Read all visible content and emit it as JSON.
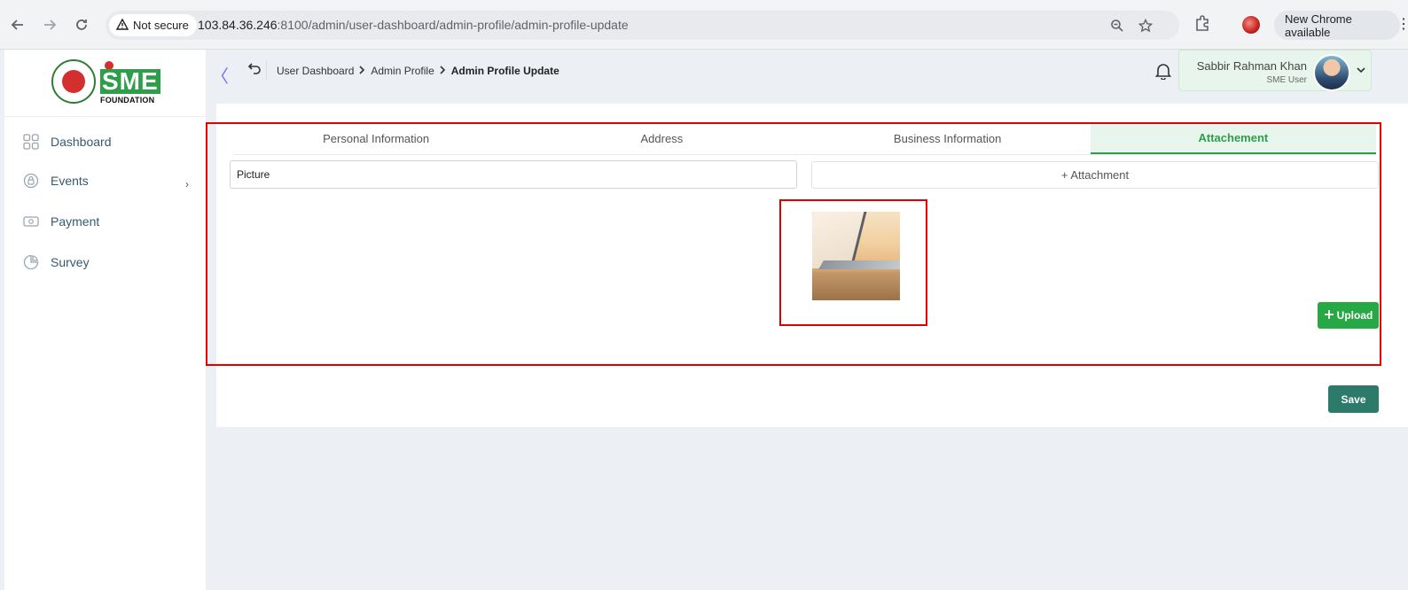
{
  "browser": {
    "security_label": "Not secure",
    "url_host": "103.84.36.246",
    "url_rest": ":8100/admin/user-dashboard/admin-profile/admin-profile-update",
    "update_label": "New Chrome available"
  },
  "sidebar": {
    "logo_text": "SME",
    "logo_subtext": "FOUNDATION",
    "items": [
      {
        "label": "Dashboard",
        "icon": "grid-icon"
      },
      {
        "label": "Events",
        "icon": "lock-icon"
      },
      {
        "label": "Payment",
        "icon": "wallet-icon"
      },
      {
        "label": "Survey",
        "icon": "pie-icon"
      }
    ]
  },
  "breadcrumb": {
    "items": [
      "User Dashboard",
      "Admin Profile"
    ],
    "current": "Admin Profile Update"
  },
  "user": {
    "name": "Sabbir Rahman Khan",
    "role": "SME User"
  },
  "tabs": [
    {
      "label": "Personal Information",
      "active": false
    },
    {
      "label": "Address",
      "active": false
    },
    {
      "label": "Business Information",
      "active": false
    },
    {
      "label": "Attachement",
      "active": true
    }
  ],
  "form": {
    "picture_value": "Picture",
    "attachment_label": "+ Attachment",
    "upload_label": "Upload",
    "save_label": "Save"
  },
  "colors": {
    "accent_green": "#2e9e4a",
    "save_teal": "#2c7a6a",
    "highlight_red": "#e00000"
  }
}
